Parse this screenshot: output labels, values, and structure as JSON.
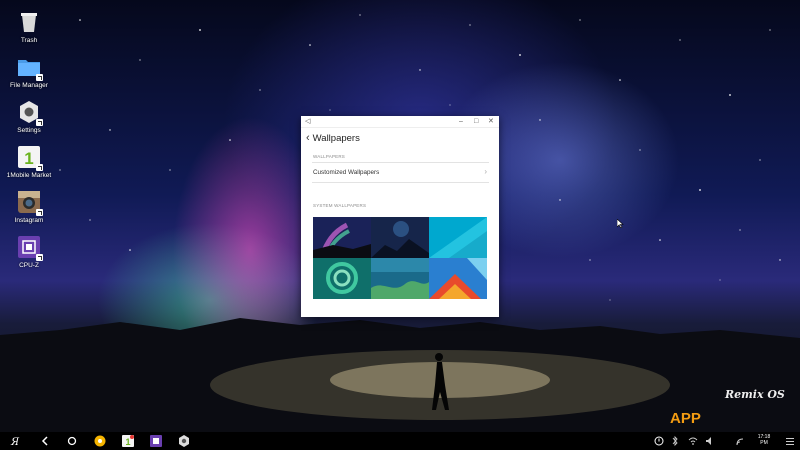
{
  "desktop": {
    "icons": [
      {
        "label": "Trash",
        "icon": "trash-icon"
      },
      {
        "label": "File Manager",
        "icon": "folder-icon"
      },
      {
        "label": "Settings",
        "icon": "settings-gear-icon"
      },
      {
        "label": "1Mobile Market",
        "icon": "1mobile-market-icon"
      },
      {
        "label": "Instagram",
        "icon": "instagram-camera-icon"
      },
      {
        "label": "CPU-Z",
        "icon": "cpu-z-chip-icon"
      }
    ]
  },
  "window": {
    "title": "Wallpapers",
    "controls": {
      "minimize": "–",
      "maximize": "□",
      "close": "✕"
    },
    "wallpapers_section": "WALLPAPERS",
    "customized_label": "Customized Wallpapers",
    "system_section": "SYSTEM WALLPAPERS",
    "system_wallpapers": [
      {
        "name": "aurora-wallpaper"
      },
      {
        "name": "mountain-night-wallpaper"
      },
      {
        "name": "teal-abstract-wallpaper"
      },
      {
        "name": "green-swirl-wallpaper"
      },
      {
        "name": "coral-reef-wallpaper"
      },
      {
        "name": "material-geometric-wallpaper"
      }
    ]
  },
  "taskbar": {
    "start": "start-menu-logo",
    "pinned": [
      "back-icon",
      "home-icon",
      "app-circle-icon",
      "market-icon",
      "cpu-z-icon",
      "settings-icon"
    ],
    "tray_icons": [
      "notification-icon",
      "bluetooth-icon",
      "wifi-icon",
      "volume-icon",
      "signal-icon",
      "menu-icon"
    ],
    "clock_time": "17:18",
    "clock_sub": "PM"
  },
  "watermark": {
    "remix": "Remix OS",
    "brand": "APP"
  },
  "colors": {
    "taskbar": "#000000",
    "window_bg": "#ffffff",
    "accent_teal": "#00bcd4"
  }
}
